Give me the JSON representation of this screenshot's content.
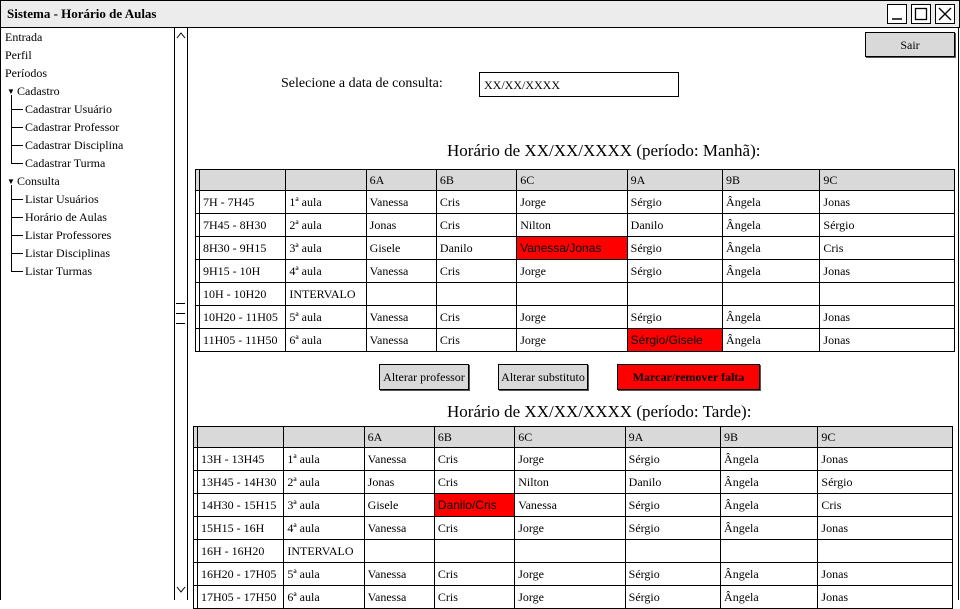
{
  "window": {
    "title": "Sistema - Horário de Aulas"
  },
  "sidebar": {
    "items": [
      {
        "label": "Entrada"
      },
      {
        "label": "Perfil"
      },
      {
        "label": "Períodos"
      },
      {
        "label": "Cadastro"
      },
      {
        "label": "Cadastrar Usuário"
      },
      {
        "label": "Cadastrar Professor"
      },
      {
        "label": "Cadastrar Disciplina"
      },
      {
        "label": "Cadastrar Turma"
      },
      {
        "label": "Consulta"
      },
      {
        "label": "Listar Usuários"
      },
      {
        "label": "Horário de Aulas"
      },
      {
        "label": "Listar Professores"
      },
      {
        "label": "Listar Disciplinas"
      },
      {
        "label": "Listar Turmas"
      }
    ]
  },
  "toolbar": {
    "sair_label": "Sair"
  },
  "query": {
    "label": "Selecione a data de consulta:",
    "value": "XX/XX/XXXX"
  },
  "morning": {
    "title": "Horário de XX/XX/XXXX (período: Manhã):",
    "headers": [
      "",
      "",
      "6A",
      "6B",
      "6C",
      "9A",
      "9B",
      "9C"
    ],
    "rows": [
      [
        "7H - 7H45",
        "1ª aula",
        "Vanessa",
        "Cris",
        "Jorge",
        "Sérgio",
        "Ângela",
        "Jonas"
      ],
      [
        "7H45 - 8H30",
        "2ª aula",
        "Jonas",
        "Cris",
        "Nilton",
        "Danilo",
        "Ângela",
        "Sérgio"
      ],
      [
        "8H30 - 9H15",
        "3ª aula",
        "Gisele",
        "Danilo",
        "Vanessa/Jonas",
        "Sérgio",
        "Ângela",
        "Cris"
      ],
      [
        "9H15 - 10H",
        "4ª aula",
        "Vanessa",
        "Cris",
        "Jorge",
        "Sérgio",
        "Ângela",
        "Jonas"
      ],
      [
        "10H - 10H20",
        "INTERVALO",
        "",
        "",
        "",
        "",
        "",
        ""
      ],
      [
        "10H20 - 11H05",
        "5ª aula",
        "Vanessa",
        "Cris",
        "Jorge",
        "Sérgio",
        "Ângela",
        "Jonas"
      ],
      [
        "11H05 - 11H50",
        "6ª aula",
        "Vanessa",
        "Cris",
        "Jorge",
        "Sérgio/Gisele",
        "Ângela",
        "Jonas"
      ]
    ]
  },
  "actions": {
    "alterar_professor": "Alterar professor",
    "alterar_substituto": "Alterar substituto",
    "marcar_falta": "Marcar/remover falta"
  },
  "afternoon": {
    "title": "Horário de XX/XX/XXXX (período: Tarde):",
    "headers": [
      "",
      "",
      "6A",
      "6B",
      "6C",
      "9A",
      "9B",
      "9C"
    ],
    "rows": [
      [
        "13H - 13H45",
        "1ª aula",
        "Vanessa",
        "Cris",
        "Jorge",
        "Sérgio",
        "Ângela",
        "Jonas"
      ],
      [
        "13H45 - 14H30",
        "2ª aula",
        "Jonas",
        "Cris",
        "Nilton",
        "Danilo",
        "Ângela",
        "Sérgio"
      ],
      [
        "14H30 - 15H15",
        "3ª aula",
        "Gisele",
        "Danilo/Cris",
        "Vanessa",
        "Sérgio",
        "Ângela",
        "Cris"
      ],
      [
        "15H15 - 16H",
        "4ª aula",
        "Vanessa",
        "Cris",
        "Jorge",
        "Sérgio",
        "Ângela",
        "Jonas"
      ],
      [
        "16H - 16H20",
        "INTERVALO",
        "",
        "",
        "",
        "",
        "",
        ""
      ],
      [
        "16H20 - 17H05",
        "5ª aula",
        "Vanessa",
        "Cris",
        "Jorge",
        "Sérgio",
        "Ângela",
        "Jonas"
      ],
      [
        "17H05 - 17H50",
        "6ª aula",
        "Vanessa",
        "Cris",
        "Jorge",
        "Sérgio",
        "Ângela",
        "Jonas"
      ]
    ]
  },
  "colors": {
    "absence": "#ff0000",
    "header_bg": "#d9d9d9"
  }
}
